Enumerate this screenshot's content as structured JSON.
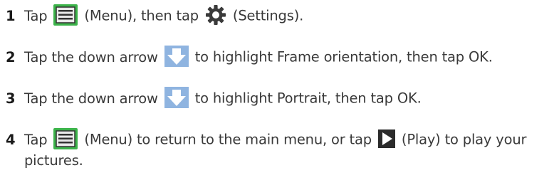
{
  "steps": [
    {
      "number": "1",
      "p1": "Tap",
      "icon1": "menu-icon",
      "p2": "(Menu), then tap",
      "icon2": "gear-icon",
      "p3": "(Settings)."
    },
    {
      "number": "2",
      "p1": "Tap the down arrow",
      "icon1": "down-arrow-icon",
      "p2": "to highlight Frame orientation, then tap OK."
    },
    {
      "number": "3",
      "p1": "Tap the down arrow",
      "icon1": "down-arrow-icon",
      "p2": "to highlight Portrait, then tap OK."
    },
    {
      "number": "4",
      "p1": "Tap",
      "icon1": "menu-icon",
      "p2": "(Menu) to return to the main menu, or tap",
      "icon2": "play-icon",
      "p3": "(Play) to play your",
      "line2": "pictures."
    }
  ],
  "colors": {
    "menu_icon_green": "#3cb34a",
    "arrow_icon_blue": "#8fb4e0",
    "text": "#3a3a3a"
  }
}
